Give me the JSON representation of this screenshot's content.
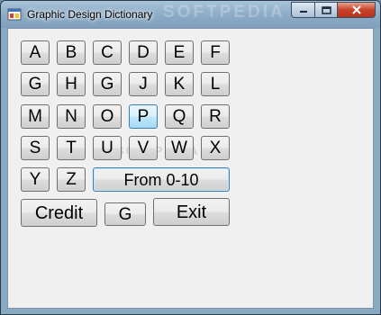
{
  "window": {
    "title": "Graphic Design Dictionary",
    "watermark": "SOFTPEDIA"
  },
  "letters_row1": [
    "A",
    "B",
    "C",
    "D",
    "E",
    "F"
  ],
  "letters_row2": [
    "G",
    "H",
    "G",
    "J",
    "K",
    "L"
  ],
  "letters_row3": [
    "M",
    "N",
    "O",
    "P",
    "Q",
    "R"
  ],
  "letters_row4": [
    "S",
    "T",
    "U",
    "V",
    "W",
    "X"
  ],
  "letters_row5": [
    "Y",
    "Z"
  ],
  "buttons": {
    "numbers": "From 0-10",
    "credit": "Credit",
    "g": "G",
    "exit": "Exit"
  },
  "content_watermark": "SOFTPEDIA",
  "colors": {
    "active_button": "#bee6fd",
    "close_button": "#c7412a"
  }
}
